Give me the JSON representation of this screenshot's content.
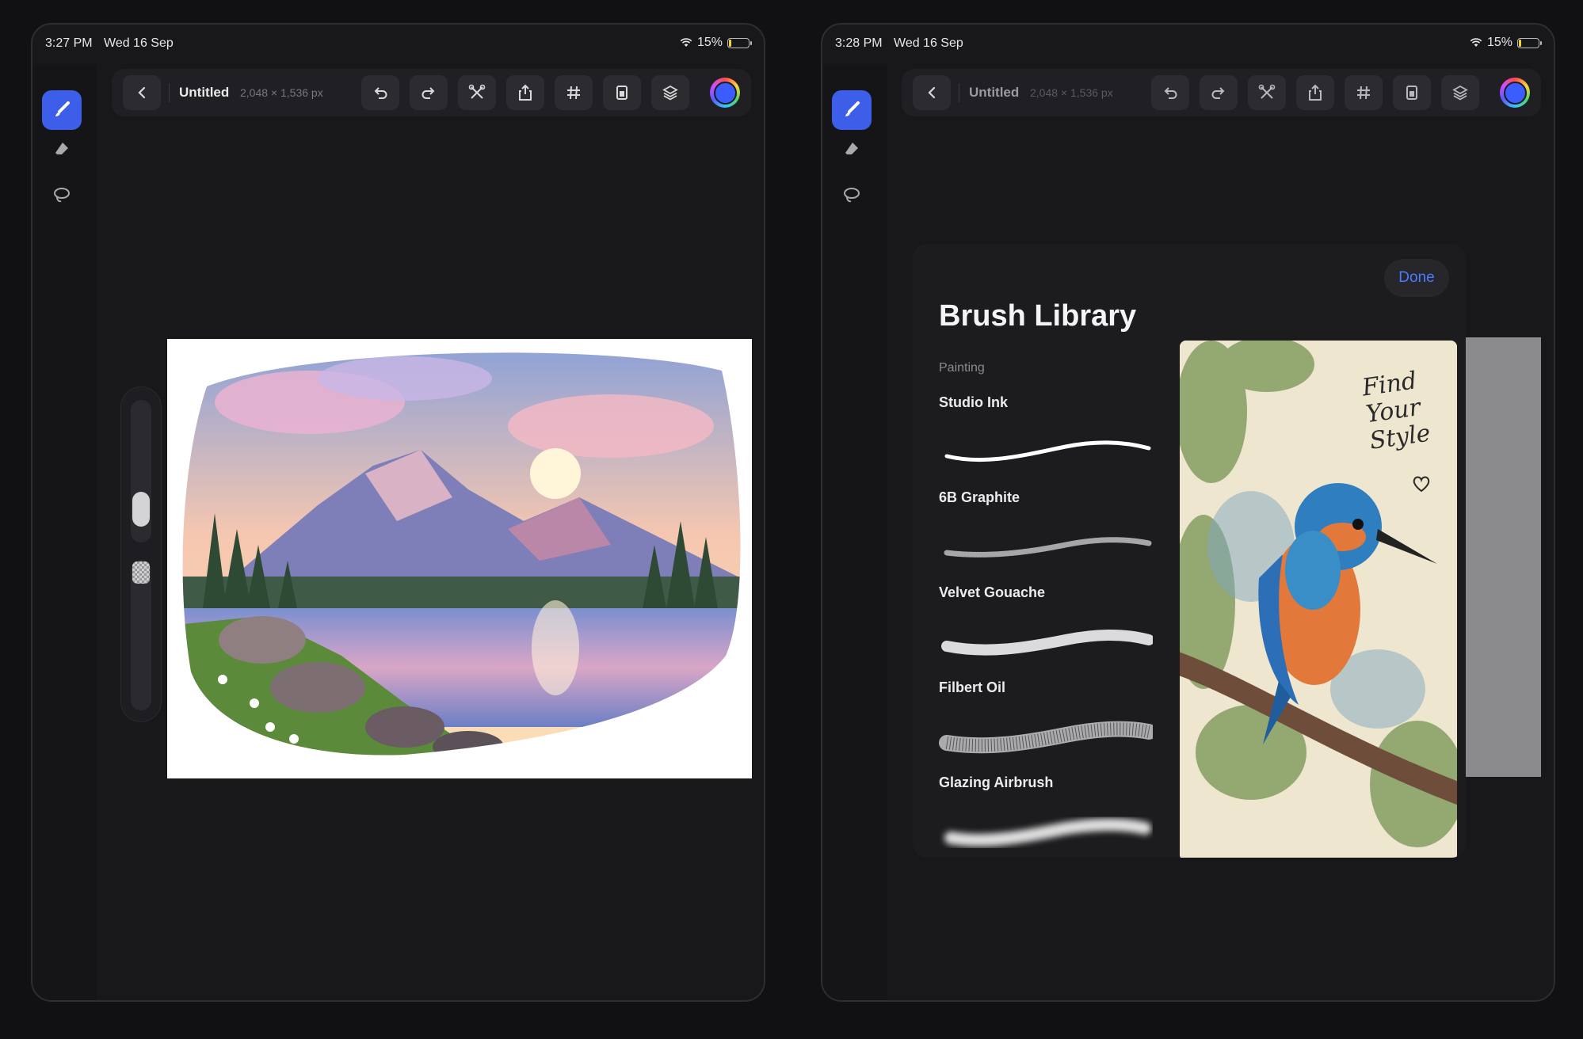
{
  "left": {
    "status": {
      "time": "3:27 PM",
      "date": "Wed 16 Sep",
      "battery": "15%",
      "battery_level": 0.15
    },
    "toolbar": {
      "title": "Untitled",
      "size": "2,048 × 1,536 px"
    }
  },
  "right": {
    "status": {
      "time": "3:28 PM",
      "date": "Wed 16 Sep",
      "battery": "15%",
      "battery_level": 0.15
    },
    "toolbar": {
      "title": "Untitled",
      "size": "2,048 × 1,536 px"
    },
    "brush_library": {
      "title": "Brush Library",
      "done_label": "Done",
      "category": "Painting",
      "brushes": [
        {
          "name": "Studio Ink"
        },
        {
          "name": "6B Graphite"
        },
        {
          "name": "Velvet Gouache"
        },
        {
          "name": "Filbert Oil"
        },
        {
          "name": "Glazing Airbrush"
        }
      ],
      "preview_text": [
        "Find",
        "Your",
        "Style"
      ]
    }
  },
  "icons": {
    "sidebar": [
      "brush-icon",
      "eraser-icon",
      "lasso-icon"
    ],
    "toolbar": [
      "back-icon",
      "undo-icon",
      "redo-icon",
      "adjustments-icon",
      "share-icon",
      "grid-icon",
      "reference-icon",
      "layers-icon",
      "color-picker-icon"
    ]
  },
  "colors": {
    "accent": "#3c5ee8",
    "done_text": "#4d7bff",
    "background": "#111113"
  }
}
